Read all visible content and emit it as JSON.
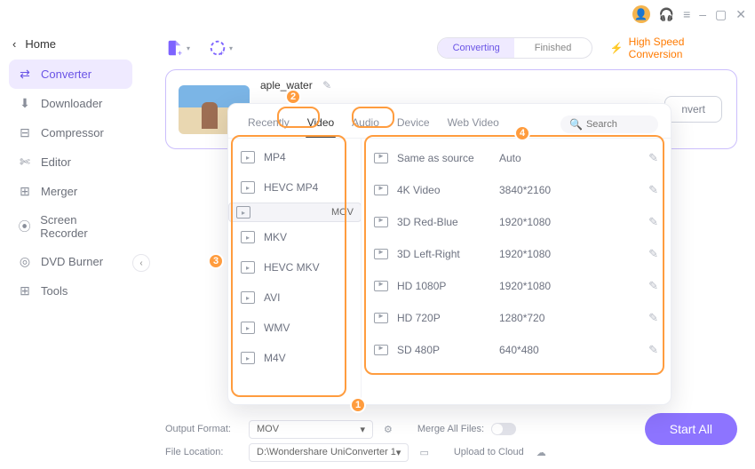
{
  "titlebar": {
    "min": "–",
    "max": "▢",
    "close": "✕"
  },
  "sidebar": {
    "back_label": "Home",
    "items": [
      {
        "label": "Converter",
        "icon": "⇄"
      },
      {
        "label": "Downloader",
        "icon": "⬇"
      },
      {
        "label": "Compressor",
        "icon": "⊟"
      },
      {
        "label": "Editor",
        "icon": "✄"
      },
      {
        "label": "Merger",
        "icon": "⊞"
      },
      {
        "label": "Screen Recorder",
        "icon": "⦿"
      },
      {
        "label": "DVD Burner",
        "icon": "◎"
      },
      {
        "label": "Tools",
        "icon": "⊞"
      }
    ]
  },
  "toolbar": {
    "converting": "Converting",
    "finished": "Finished",
    "hsc": "High Speed Conversion"
  },
  "card": {
    "filename": "aple_water",
    "convert": "nvert"
  },
  "popup": {
    "tabs": [
      "Recently",
      "Video",
      "Audio",
      "Device",
      "Web Video"
    ],
    "search": "Search",
    "formats": [
      "MP4",
      "HEVC MP4",
      "MOV",
      "MKV",
      "HEVC MKV",
      "AVI",
      "WMV",
      "M4V"
    ],
    "resolutions": [
      {
        "n": "Same as source",
        "v": "Auto"
      },
      {
        "n": "4K Video",
        "v": "3840*2160"
      },
      {
        "n": "3D Red-Blue",
        "v": "1920*1080"
      },
      {
        "n": "3D Left-Right",
        "v": "1920*1080"
      },
      {
        "n": "HD 1080P",
        "v": "1920*1080"
      },
      {
        "n": "HD 720P",
        "v": "1280*720"
      },
      {
        "n": "SD 480P",
        "v": "640*480"
      }
    ]
  },
  "footer": {
    "output_label": "Output Format:",
    "output_value": "MOV",
    "location_label": "File Location:",
    "location_value": "D:\\Wondershare UniConverter 1",
    "merge": "Merge All Files:",
    "cloud": "Upload to Cloud",
    "start": "Start All"
  },
  "badges": {
    "b1": "1",
    "b2": "2",
    "b3": "3",
    "b4": "4"
  }
}
